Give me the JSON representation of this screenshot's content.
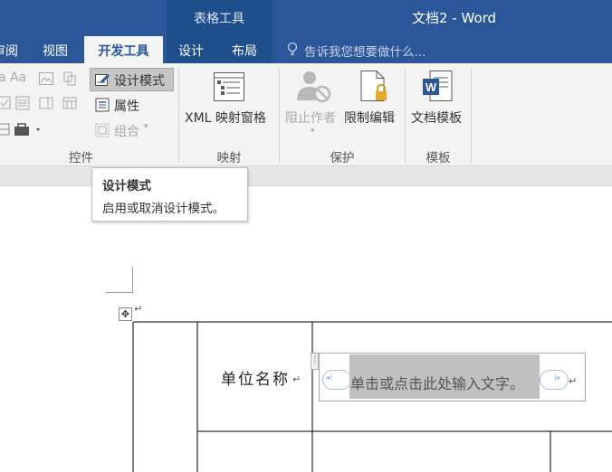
{
  "window": {
    "contextual_group": "表格工具",
    "document_title": "文档2 - Word"
  },
  "tabs": {
    "review": "审阅",
    "view": "视图",
    "developer": "开发工具",
    "design": "设计",
    "layout": "布局",
    "tell_me": "告诉我您想要做什么..."
  },
  "ribbon": {
    "controls_group": {
      "label": "控件",
      "design_mode": "设计模式",
      "properties": "属性",
      "group": "组合"
    },
    "mapping_group": {
      "label": "映射",
      "xml_pane": "XML 映射窗格"
    },
    "protect_group": {
      "label": "保护",
      "block_authors": "阻止作者",
      "restrict_editing": "限制编辑"
    },
    "templates_group": {
      "label": "模板",
      "document_template": "文档模板"
    }
  },
  "tooltip": {
    "title": "设计模式",
    "description": "启用或取消设计模式。"
  },
  "document": {
    "table": {
      "row1_label": "单位名称",
      "content_control_placeholder": "单击或点击此处输入文字。"
    }
  },
  "colors": {
    "title_bar": "#2b579a",
    "context_group": "#1f4e8c",
    "ribbon_bg": "#f3f3f3",
    "design_mode_pressed": "#c5c5c5"
  }
}
